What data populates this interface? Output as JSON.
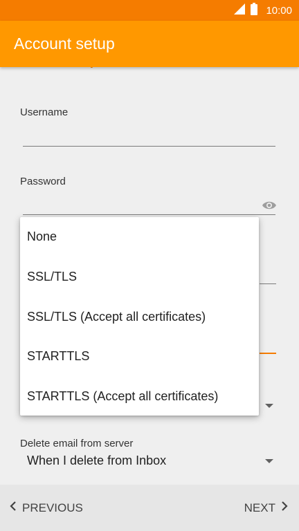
{
  "status_bar": {
    "time": "10:00",
    "signal_icon": "signal-icon",
    "battery_icon": "battery-icon"
  },
  "app_bar": {
    "title": "Account setup"
  },
  "heading_peek": "g",
  "form": {
    "username": {
      "label": "Username",
      "value": ""
    },
    "password": {
      "label": "Password",
      "value": "",
      "toggle_icon": "eye-icon"
    },
    "delete_email": {
      "label": "Delete email from server",
      "value": "When I delete from Inbox"
    }
  },
  "security_dropdown": {
    "options": [
      "None",
      "SSL/TLS",
      "SSL/TLS (Accept all certificates)",
      "STARTTLS",
      "STARTTLS (Accept all certificates)"
    ]
  },
  "bottom_nav": {
    "previous": "PREVIOUS",
    "next": "NEXT"
  },
  "colors": {
    "status_bar": "#f57c00",
    "app_bar": "#ff9800",
    "accent": "#f57c00",
    "background": "#efefef"
  }
}
